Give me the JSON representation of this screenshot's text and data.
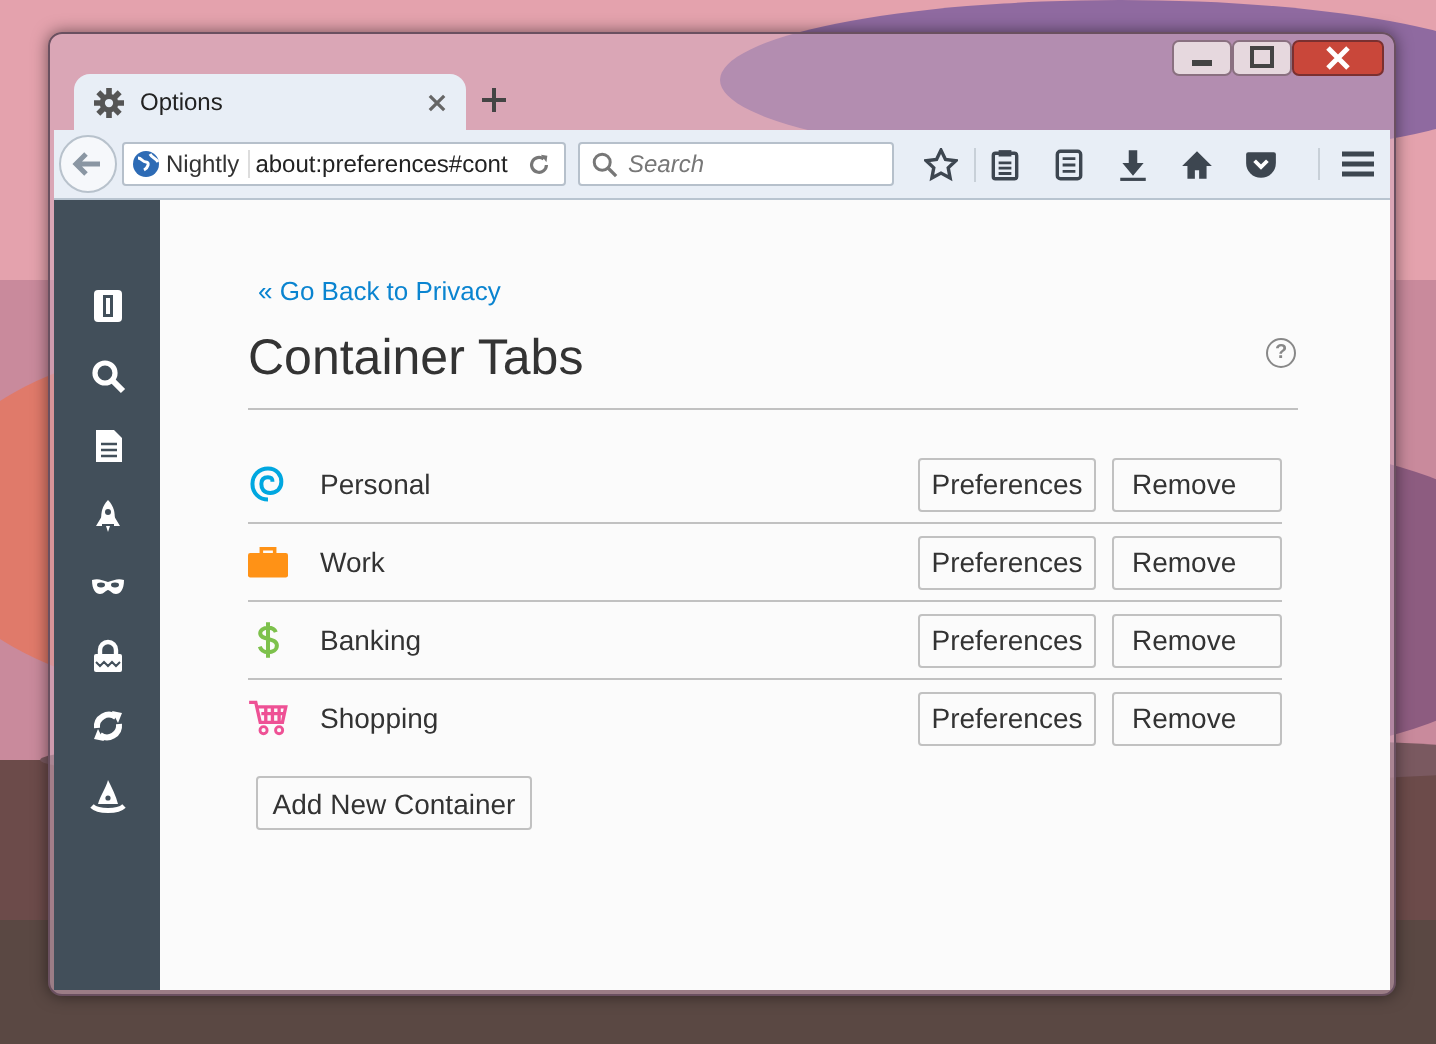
{
  "window": {
    "tab": {
      "title": "Options",
      "selected": true
    }
  },
  "toolbar": {
    "identity": "Nightly",
    "url": "about:preferences#cont",
    "search": {
      "placeholder": "Search"
    }
  },
  "page": {
    "back_link": "« Go Back to Privacy",
    "title": "Container Tabs",
    "help_button": "?",
    "containers": [
      {
        "name": "Personal",
        "kind": "fingerprint",
        "color": "#00a7e0",
        "buttons": [
          "Preferences",
          "Remove"
        ]
      },
      {
        "name": "Work",
        "kind": "briefcase",
        "color": "#ff9216",
        "buttons": [
          "Preferences",
          "Remove"
        ]
      },
      {
        "name": "Banking",
        "kind": "dollar",
        "color": "#7dc14c",
        "buttons": [
          "Preferences",
          "Remove"
        ]
      },
      {
        "name": "Shopping",
        "kind": "cart",
        "color": "#ee5195",
        "buttons": [
          "Preferences",
          "Remove"
        ]
      }
    ],
    "add_button": "Add New Container"
  }
}
